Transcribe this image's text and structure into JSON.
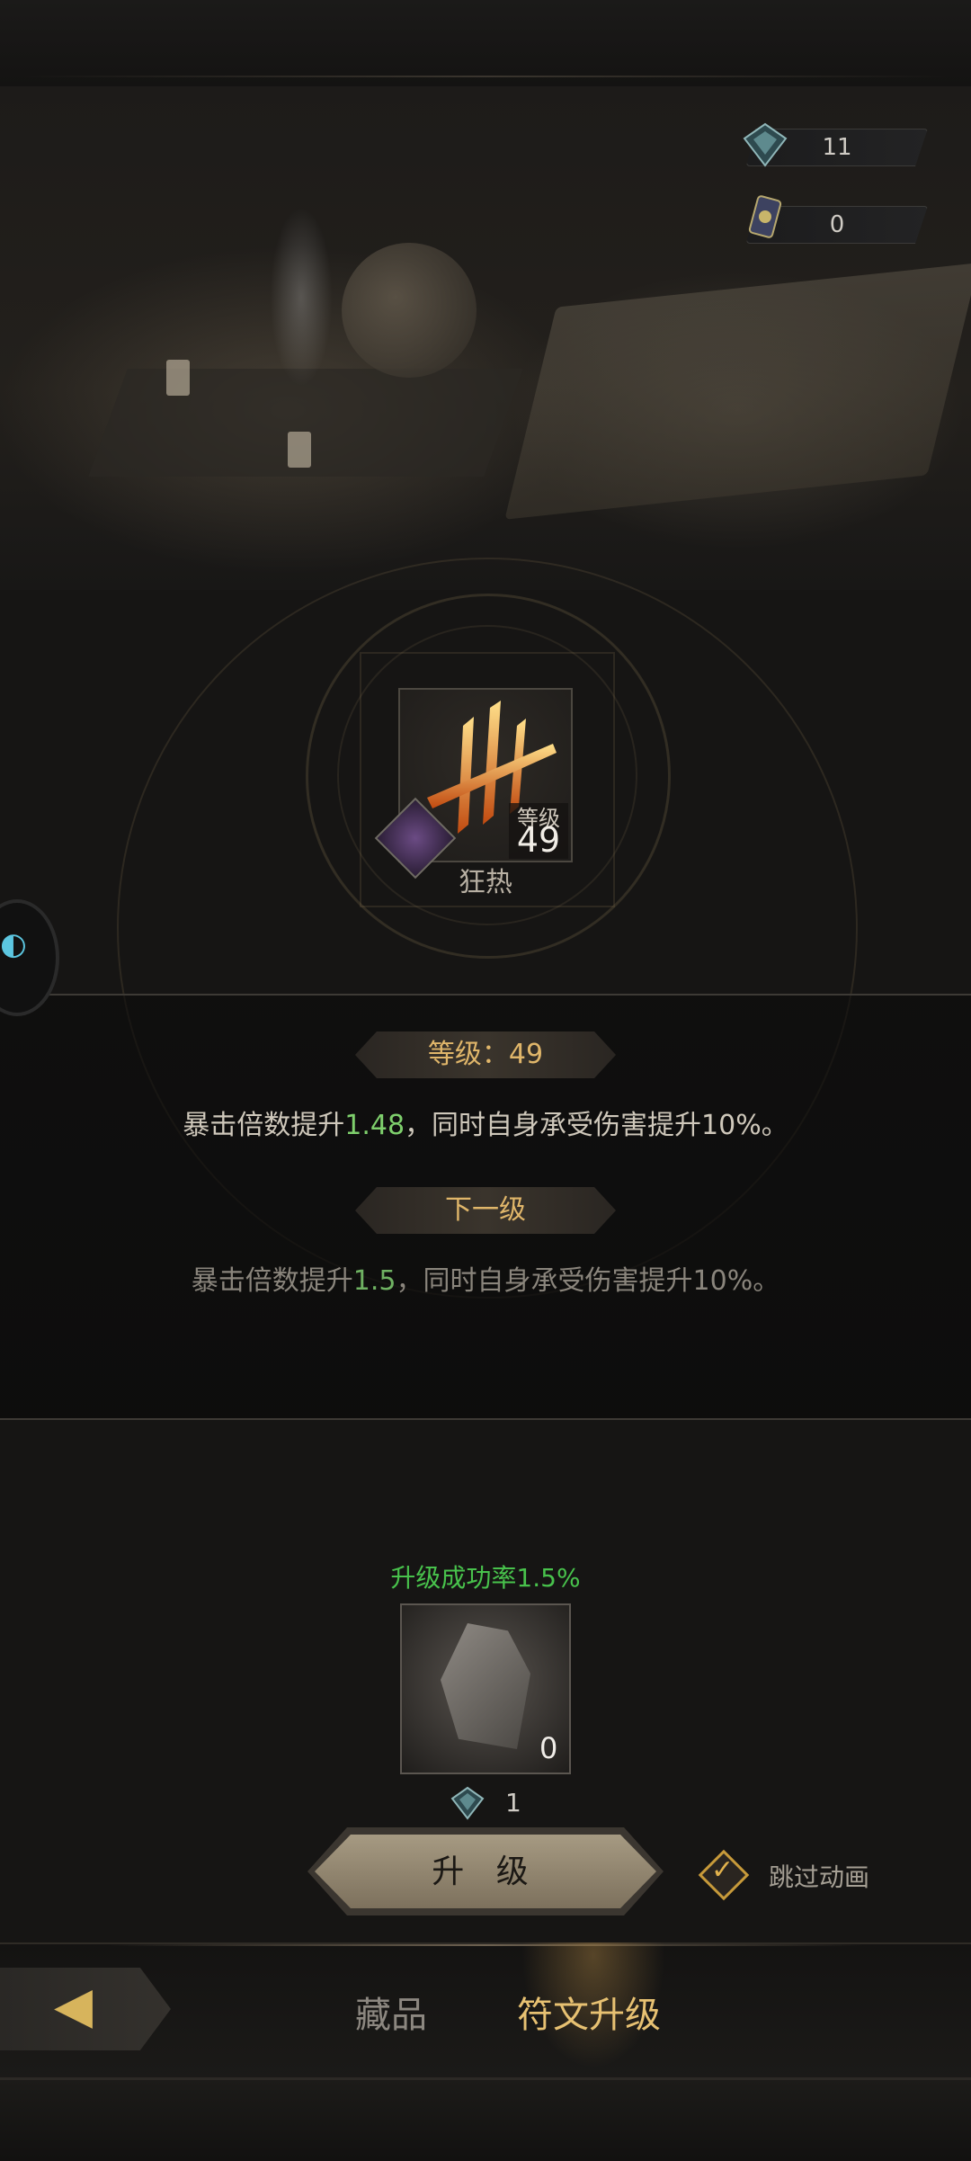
{
  "resources": [
    {
      "icon": "rune-crystal-icon",
      "value": "11"
    },
    {
      "icon": "rune-scroll-icon",
      "value": "0"
    }
  ],
  "item": {
    "name": "狂热",
    "level_label": "等级",
    "level_value": "49",
    "gem_icon": "purple-gem-icon"
  },
  "current": {
    "pill": "等级：49",
    "desc_pre": "暴击倍数提升",
    "desc_num": "1.48",
    "desc_post": "，同时自身承受伤害提升10%。"
  },
  "next": {
    "pill": "下一级",
    "desc_pre": "暴击倍数提升",
    "desc_num": "1.5",
    "desc_post": "，同时自身承受伤害提升10%。"
  },
  "upgrade": {
    "success_rate": "升级成功率1.5%",
    "material_count": "0",
    "cost_value": "1",
    "button_label": "升 级",
    "skip_label": "跳过动画"
  },
  "nav": {
    "tabs": [
      "藏品",
      "符文升级"
    ],
    "active": "符文升级"
  },
  "colors": {
    "accent_gold": "#e0b66a",
    "value_green": "#7ecf6c",
    "success_green": "#48c24c",
    "active_tab": "#e7c172"
  }
}
